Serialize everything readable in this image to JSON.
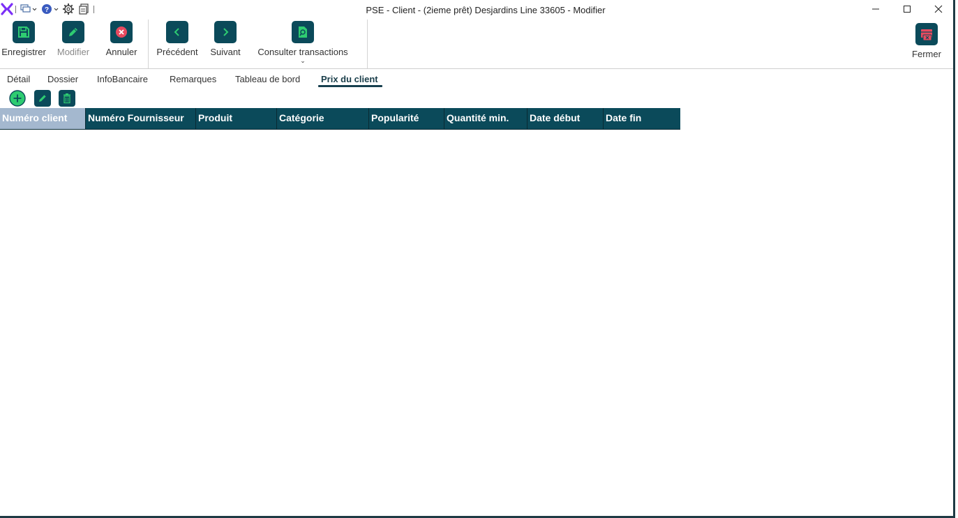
{
  "window": {
    "title": "PSE - Client - (2ieme prêt) Desjardins Line 33605 - Modifier",
    "controls": [
      "minimize",
      "maximize",
      "close"
    ]
  },
  "quick_access": [
    "app-logo-icon",
    "windows-icon",
    "help-icon",
    "settings-icon",
    "document-icon"
  ],
  "toolbar": {
    "save_label": "Enregistrer",
    "edit_label": "Modifier",
    "cancel_label": "Annuler",
    "previous_label": "Précédent",
    "next_label": "Suivant",
    "transactions_label": "Consulter transactions",
    "close_label": "Fermer"
  },
  "tabs": [
    {
      "label": "Détail"
    },
    {
      "label": "Dossier"
    },
    {
      "label": "InfoBancaire"
    },
    {
      "label": "Remarques"
    },
    {
      "label": "Tableau de bord"
    },
    {
      "label": "Prix du client",
      "active": true
    }
  ],
  "grid": {
    "columns": [
      "Numéro client",
      "Numéro Fournisseur",
      "Produit",
      "Catégorie",
      "Popularité",
      "Quantité min.",
      "Date début",
      "Date fin"
    ],
    "selected_column": "Numéro client",
    "rows": []
  },
  "colors": {
    "accent": "#0b4a5a",
    "icon_green": "#2ecc71",
    "cancel_red": "#e84a5f",
    "header_selected": "#a4b8cf",
    "logo_purple": "#7b2ff7"
  }
}
